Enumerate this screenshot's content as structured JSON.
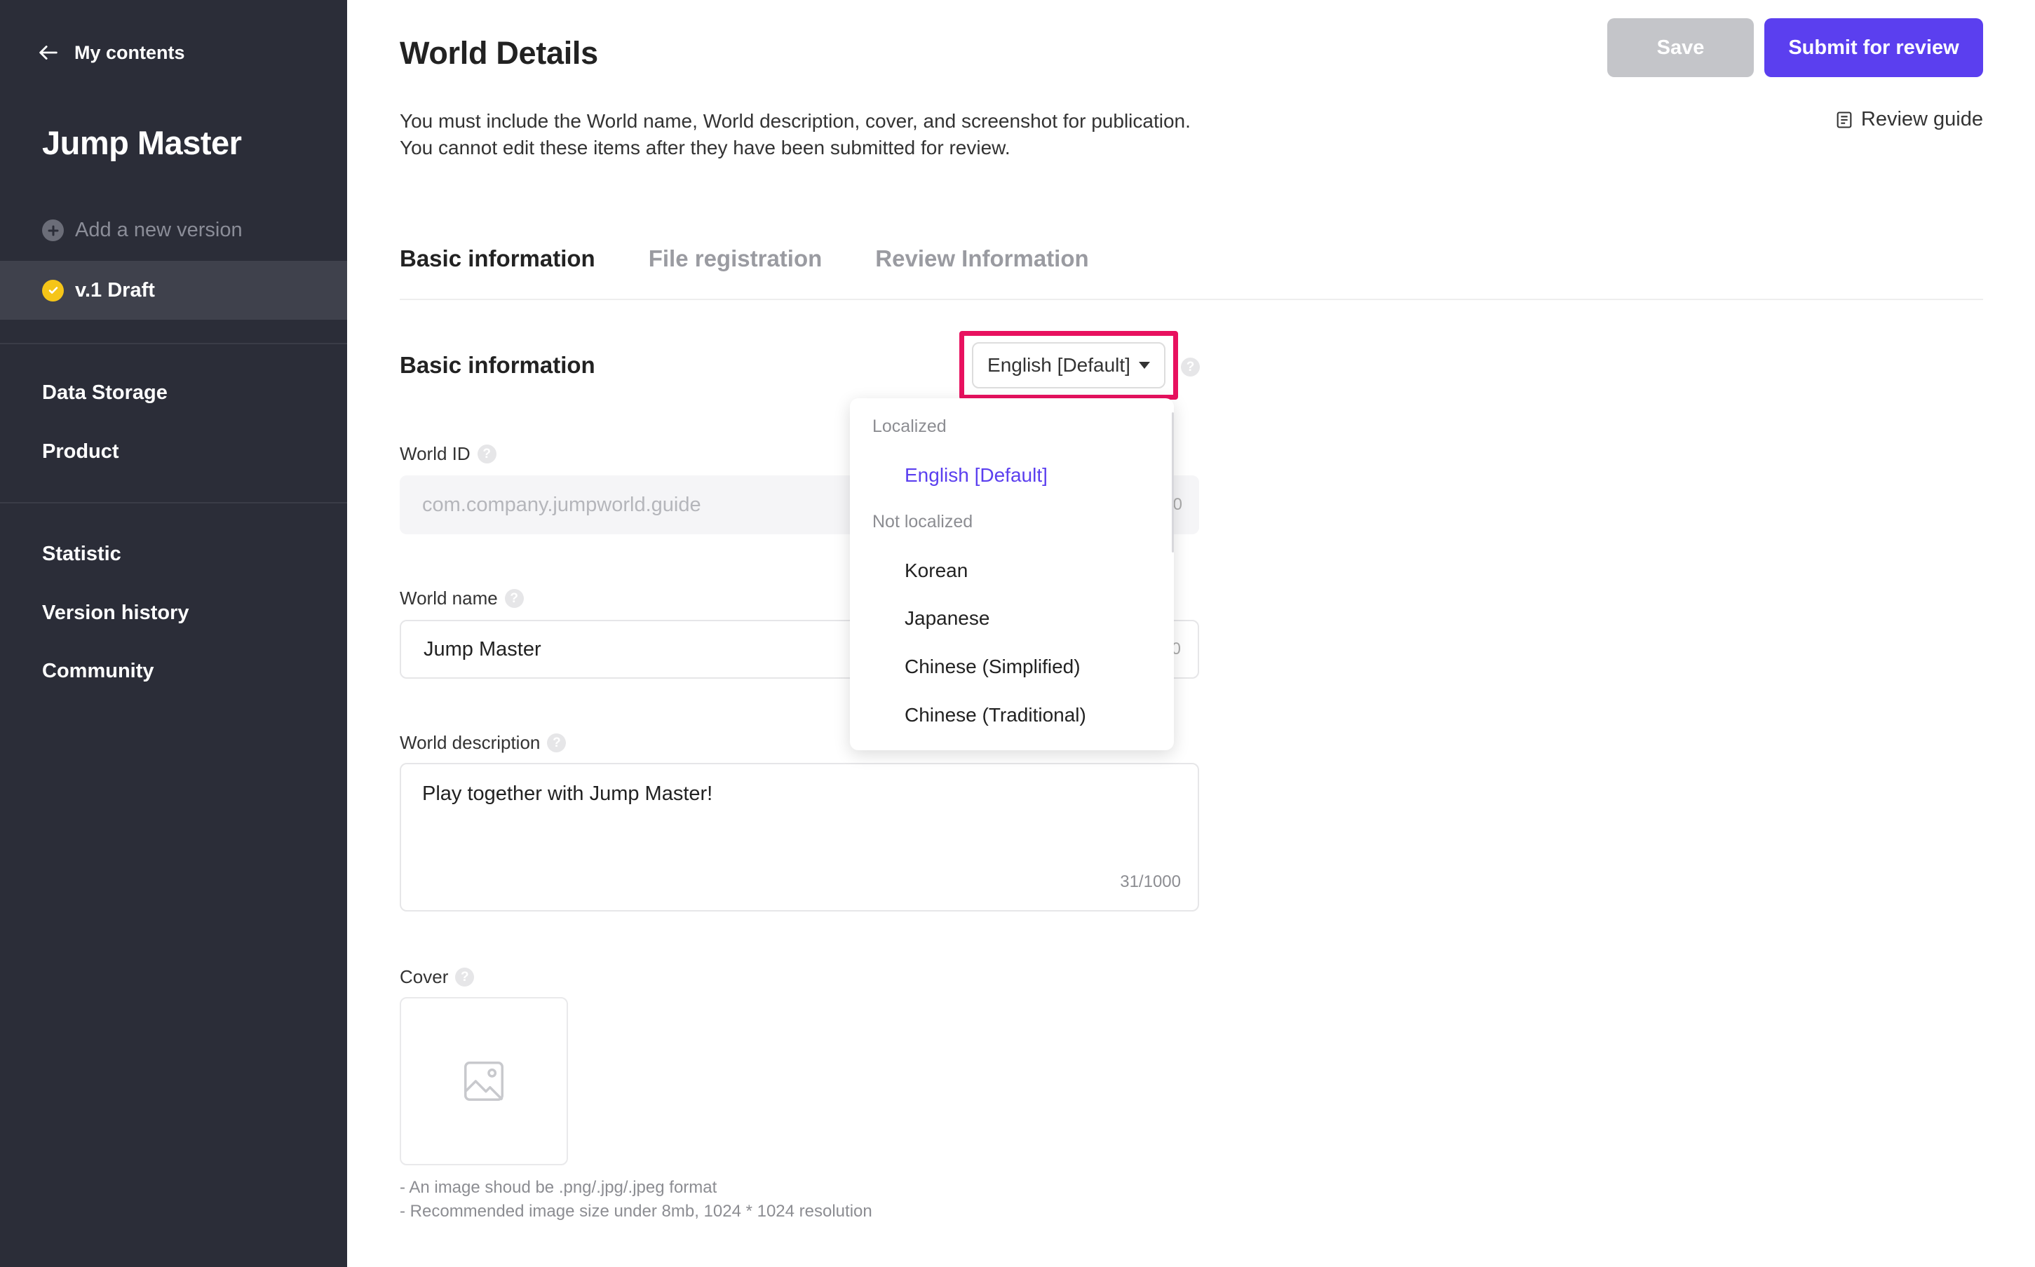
{
  "sidebar": {
    "back_label": "My contents",
    "app_title": "Jump Master",
    "add_version_label": "Add a new version",
    "active_version_label": "v.1 Draft",
    "items_top": [
      "Data Storage",
      "Product"
    ],
    "items_bottom": [
      "Statistic",
      "Version history",
      "Community"
    ]
  },
  "header": {
    "title": "World Details",
    "save_label": "Save",
    "submit_label": "Submit for review",
    "notice_line1": "You must include the World name, World description, cover, and screenshot for publication.",
    "notice_line2": "You cannot edit these items after they have been submitted for review.",
    "review_guide_label": "Review guide"
  },
  "tabs": [
    "Basic information",
    "File registration",
    "Review Information"
  ],
  "section": {
    "title": "Basic information",
    "language_selected": "English [Default]",
    "help_glyph": "?"
  },
  "fields": {
    "world_id": {
      "label": "World ID",
      "value": "com.company.jumpworld.guide",
      "suffix": "0"
    },
    "world_name": {
      "label": "World name",
      "value": "Jump Master",
      "suffix": "0"
    },
    "world_description": {
      "label": "World description",
      "value": "Play together with Jump Master!",
      "counter": "31/1000"
    },
    "cover": {
      "label": "Cover",
      "hint1": "- An image shoud be .png/.jpg/.jpeg format",
      "hint2": "- Recommended image size under 8mb, 1024 * 1024 resolution"
    }
  },
  "language_dropdown": {
    "group_localized": "Localized",
    "localized": [
      "English [Default]"
    ],
    "group_not_localized": "Not localized",
    "not_localized": [
      "Korean",
      "Japanese",
      "Chinese (Simplified)",
      "Chinese (Traditional)"
    ]
  },
  "colors": {
    "sidebar_bg": "#2b2d38",
    "accent": "#5b3fef",
    "highlight": "#e8115f",
    "draft_badge": "#f5c518"
  },
  "icons": {
    "back": "arrow-left-icon",
    "add": "plus-circle-icon",
    "draft": "check-circle-icon",
    "guide": "document-icon",
    "help": "question-circle-icon",
    "dropdown": "caret-down-icon",
    "cover": "image-placeholder-icon"
  }
}
